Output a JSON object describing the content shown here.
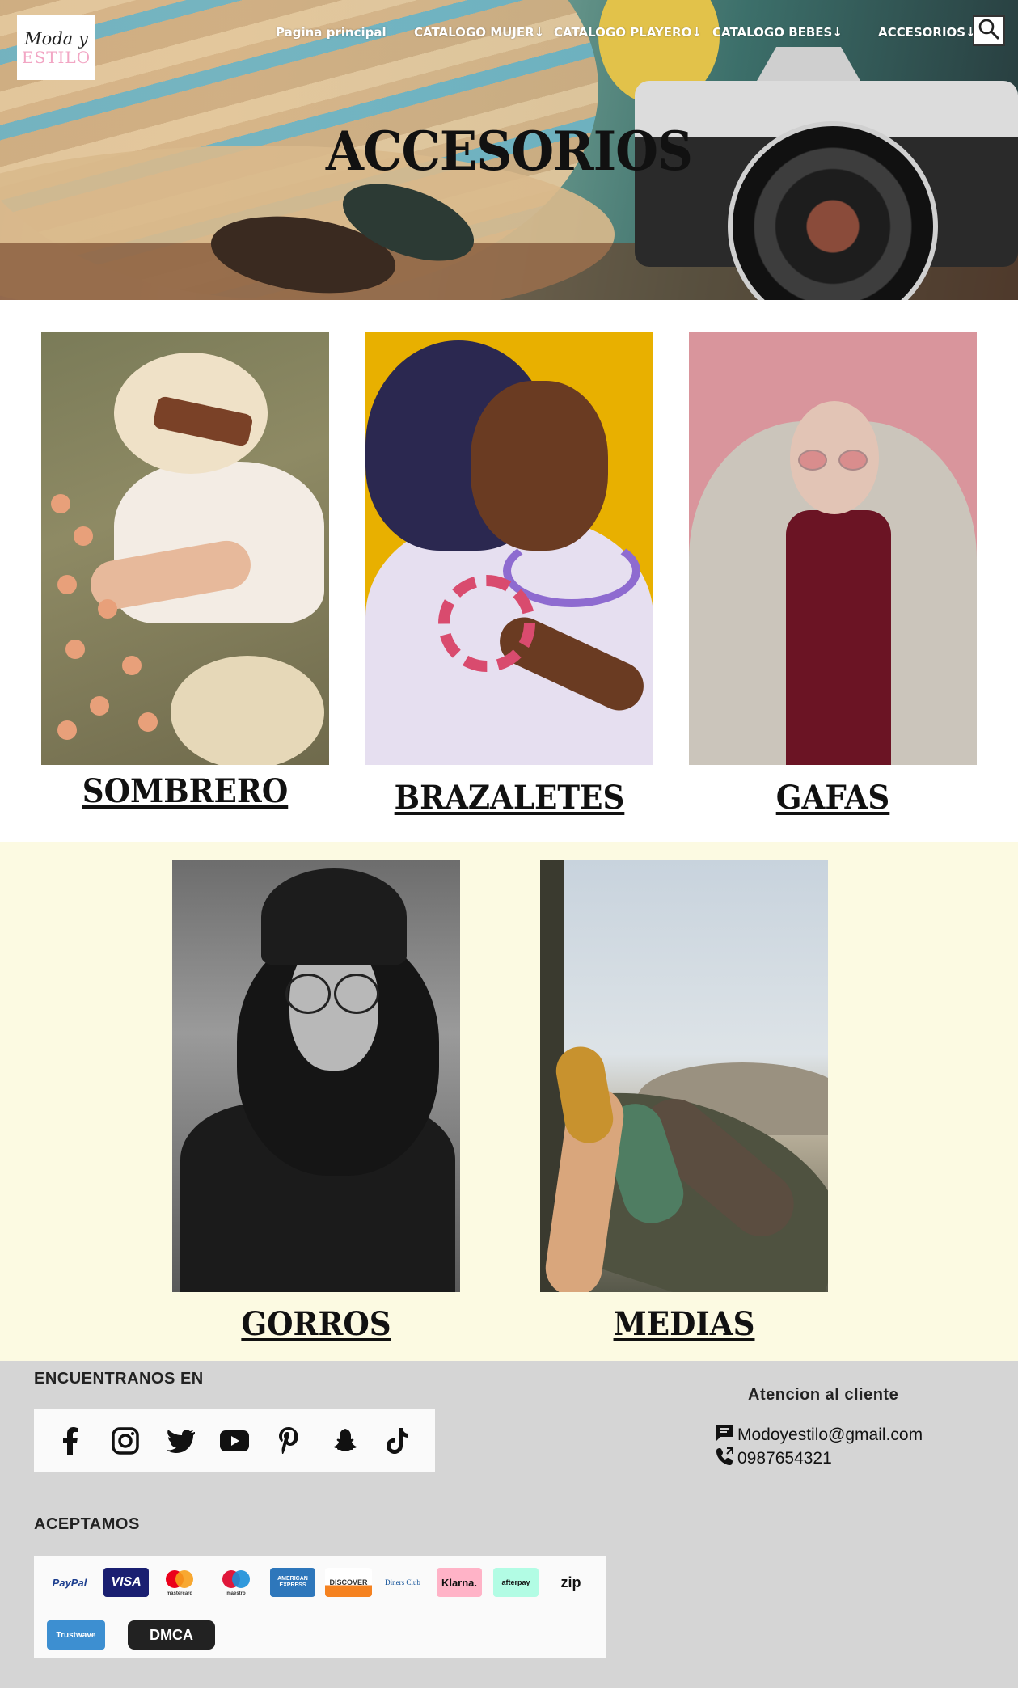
{
  "brand": {
    "logo_line1": "Moda y",
    "logo_line2": "ESTILO"
  },
  "nav": {
    "items": [
      {
        "label": "Pagina principal"
      },
      {
        "label": "CATALOGO MUJER↓"
      },
      {
        "label": "CATALOGO PLAYERO↓"
      },
      {
        "label": "CATALOGO BEBES↓"
      },
      {
        "label": "ACCESORIOS↓"
      }
    ],
    "search_icon": "search-icon"
  },
  "hero": {
    "title": "ACCESORIOS"
  },
  "products": [
    {
      "label": "SOMBRERO"
    },
    {
      "label": "BRAZALETES"
    },
    {
      "label": "GAFAS"
    },
    {
      "label": "GORROS "
    },
    {
      "label": "MEDIAS"
    }
  ],
  "footer": {
    "find_us_heading": "ENCUENTRANOS EN",
    "social_icons": [
      "facebook-icon",
      "instagram-icon",
      "twitter-icon",
      "youtube-icon",
      "pinterest-icon",
      "snapchat-icon",
      "tiktok-icon"
    ],
    "accept_heading": "ACEPTAMOS",
    "payments": [
      "PayPal",
      "VISA",
      "mastercard",
      "maestro",
      "AMERICAN EXPRESS",
      "DISCOVER",
      "Diners Club",
      "Klarna.",
      "afterpay",
      "zip",
      "Trustwave",
      "DMCA"
    ],
    "customer_service_heading": "Atencion al cliente",
    "email": "Modoyestilo@gmail.com",
    "phone": "0987654321"
  },
  "colors": {
    "band_background": "#fcfae2",
    "footer_background": "#d5d5d5",
    "logo_pink": "#f2a6c4"
  }
}
